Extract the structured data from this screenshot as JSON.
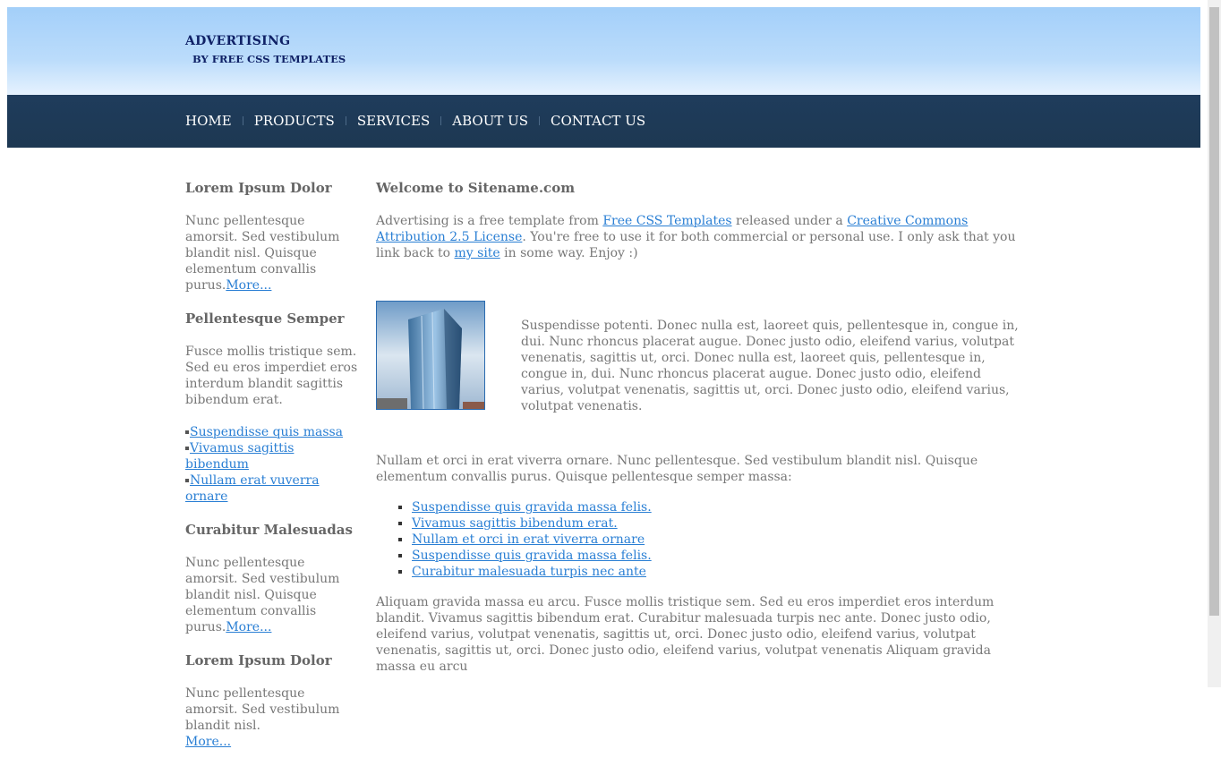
{
  "header": {
    "title": "ADVERTISING",
    "subtitle": "BY FREE CSS TEMPLATES"
  },
  "nav": {
    "items": [
      "HOME",
      "PRODUCTS",
      "SERVICES",
      "ABOUT US",
      "CONTACT US"
    ]
  },
  "sidebar": {
    "section1": {
      "heading": "Lorem Ipsum Dolor",
      "text": "Nunc pellentesque amorsit. Sed vestibulum blandit nisl. Quisque elementum convallis purus.",
      "more": "More..."
    },
    "section2": {
      "heading": "Pellentesque Semper",
      "text": "Fusce mollis tristique sem. Sed eu eros imperdiet eros interdum blandit sagittis bibendum erat.",
      "links": [
        "Suspendisse quis massa",
        "Vivamus sagittis bibendum",
        "Nullam erat vuverra ornare"
      ]
    },
    "section3": {
      "heading": "Curabitur Malesuadas",
      "text": "Nunc pellentesque amorsit. Sed vestibulum blandit nisl. Quisque elementum convallis purus.",
      "more": "More..."
    },
    "section4": {
      "heading": "Lorem Ipsum Dolor",
      "text": "Nunc pellentesque amorsit. Sed vestibulum blandit nisl.",
      "more": "More..."
    }
  },
  "main": {
    "heading": "Welcome to Sitename.com",
    "intro": {
      "t1": "Advertising is a free template from ",
      "link1": "Free CSS Templates",
      "t2": " released under a ",
      "link2": "Creative Commons Attribution 2.5 License",
      "t3": ". You're free to use it for both commercial or personal use. I only ask that you link back to ",
      "link3": "my site",
      "t4": " in some way. Enjoy :)"
    },
    "feature_text": "Suspendisse potenti. Donec nulla est, laoreet quis, pellentesque in, congue in, dui. Nunc rhoncus placerat augue. Donec justo odio, eleifend varius, volutpat venenatis, sagittis ut, orci. Donec nulla est, laoreet quis, pellentesque in, congue in, dui. Nunc rhoncus placerat augue. Donec justo odio, eleifend varius, volutpat venenatis, sagittis ut, orci. Donec justo odio, eleifend varius, volutpat venenatis.",
    "para2": "Nullam et orci in erat viverra ornare. Nunc pellentesque. Sed vestibulum blandit nisl. Quisque elementum convallis purus. Quisque pellentesque semper massa:",
    "list": [
      "Suspendisse quis gravida massa felis.",
      "Vivamus sagittis bibendum erat.",
      "Nullam et orci in erat viverra ornare",
      "Suspendisse quis gravida massa felis.",
      "Curabitur malesuada turpis nec ante"
    ],
    "para3": "Aliquam gravida massa eu arcu. Fusce mollis tristique sem. Sed eu eros imperdiet eros interdum blandit. Vivamus sagittis bibendum erat. Curabitur malesuada turpis nec ante. Donec justo odio, eleifend varius, volutpat venenatis, sagittis ut, orci. Donec justo odio, eleifend varius, volutpat venenatis, sagittis ut, orci. Donec justo odio, eleifend varius, volutpat venenatis Aliquam gravida massa eu arcu"
  },
  "colors": {
    "header_light": "#bbdcfb",
    "nav_bg": "#1f3c5c",
    "title_color": "#0f2166",
    "link_color": "#2a7fd4",
    "text_color": "#777777"
  },
  "icons": {
    "feature_image": "office-building-image"
  }
}
